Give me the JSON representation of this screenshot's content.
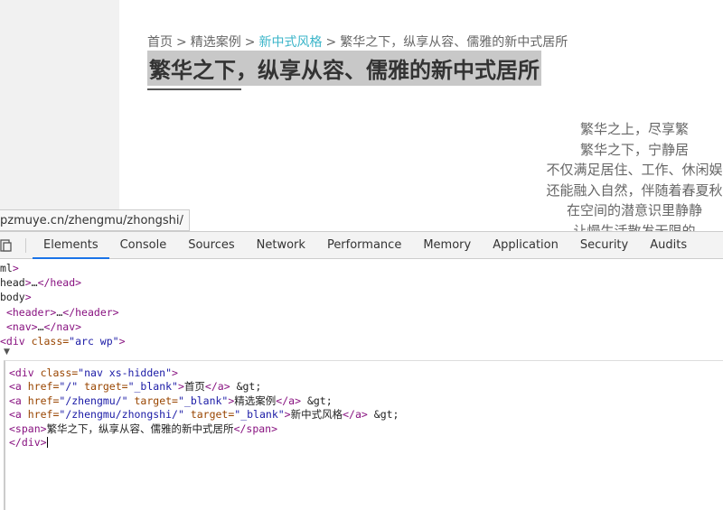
{
  "page": {
    "breadcrumb": {
      "items": [
        "首页",
        "精选案例",
        "新中式风格",
        "繁华之下，纵享从容、儒雅的新中式居所"
      ],
      "separator": ">"
    },
    "title": "繁华之下，纵享从容、儒雅的新中式居所",
    "poem": [
      "繁华之上，尽享繁",
      "繁华之下，宁静居",
      "不仅满足居住、工作、休闲娱",
      "还能融入自然，伴随着春夏秋",
      "在空间的潜意识里静静",
      "让慢生活散发无限的"
    ]
  },
  "status_url": "pzmuye.cn/zhengmu/zhongshi/",
  "devtools": {
    "tabs": [
      "Elements",
      "Console",
      "Sources",
      "Network",
      "Performance",
      "Memory",
      "Application",
      "Security",
      "Audits"
    ],
    "active_tab": "Elements",
    "dom_lines": [
      [
        "tag",
        "ml>"
      ],
      [
        "tag",
        "head>…</head>"
      ],
      [
        "tag",
        "body>"
      ],
      [
        "tag",
        " <header>…</header>"
      ],
      [
        "tag",
        " <nav>…</nav>"
      ],
      [
        "mixed",
        "<div class=\"arc wp\">"
      ]
    ],
    "code": [
      "<div class=\"nav xs-hidden\">",
      "<a href=\"/\" target=\"_blank\">首页</a> &gt;",
      "<a href=\"/zhengmu/\" target=\"_blank\">精选案例</a> &gt;",
      "<a href=\"/zhengmu/zhongshi/\" target=\"_blank\">新中式风格</a> &gt;",
      "<span>繁华之下，纵享从容、儒雅的新中式居所</span>",
      "</div>"
    ]
  },
  "colors": {
    "accent": "#3bb5c9",
    "tag": "#881280",
    "attr": "#994500",
    "value": "#1a1aa6",
    "active_tab": "#1a73e8"
  }
}
